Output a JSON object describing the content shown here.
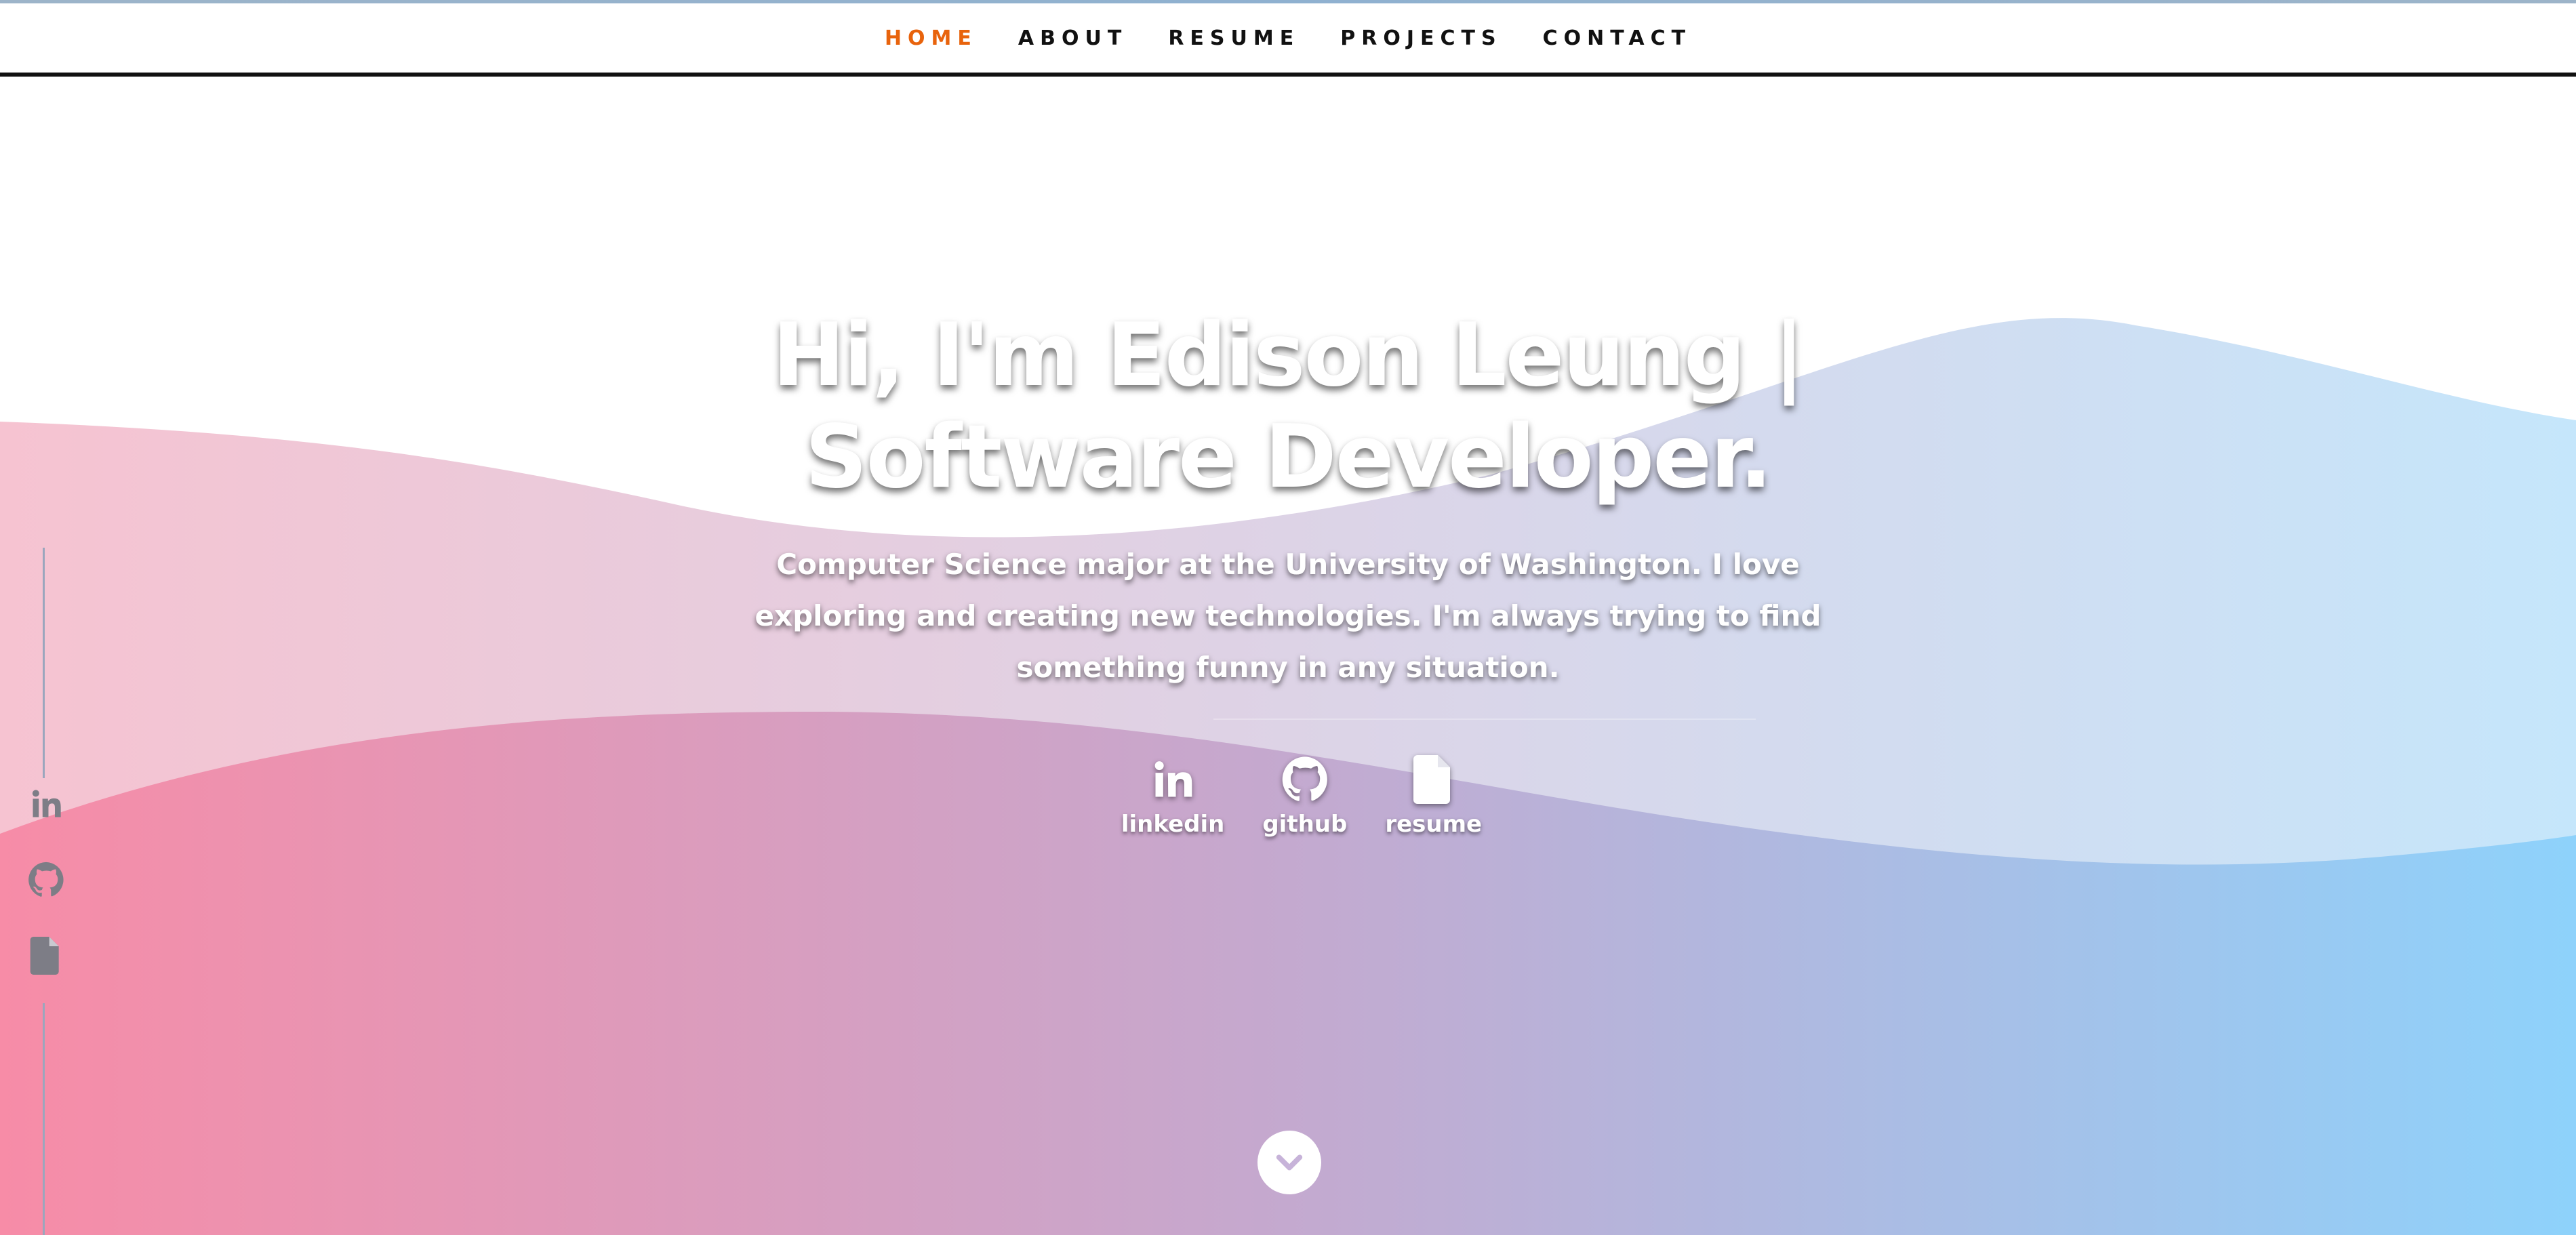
{
  "nav": {
    "items": [
      {
        "label": "HOME",
        "active": true
      },
      {
        "label": "ABOUT",
        "active": false
      },
      {
        "label": "RESUME",
        "active": false
      },
      {
        "label": "PROJECTS",
        "active": false
      },
      {
        "label": "CONTACT",
        "active": false
      }
    ],
    "active_color": "#e8630c",
    "text_color": "#111111"
  },
  "hero": {
    "title": "Hi, I'm Edison Leung | Software Developer.",
    "description": "Computer Science major at the University of Washington. I love exploring and creating new technologies. I'm always trying to find something funny in any situation.",
    "social": [
      {
        "label": "linkedin",
        "icon": "linkedin-icon"
      },
      {
        "label": "github",
        "icon": "github-icon"
      },
      {
        "label": "resume",
        "icon": "file-icon"
      }
    ]
  },
  "side_rail": {
    "icons": [
      "linkedin-icon",
      "github-icon",
      "file-icon"
    ],
    "icon_color": "#7d7d86"
  },
  "scroll_button": {
    "icon": "chevron-down-icon",
    "color": "#c7b3d9"
  },
  "colors": {
    "gradient_left": "#f78ca7",
    "gradient_mid": "#c4a9cf",
    "gradient_right": "#8ed2fb"
  }
}
